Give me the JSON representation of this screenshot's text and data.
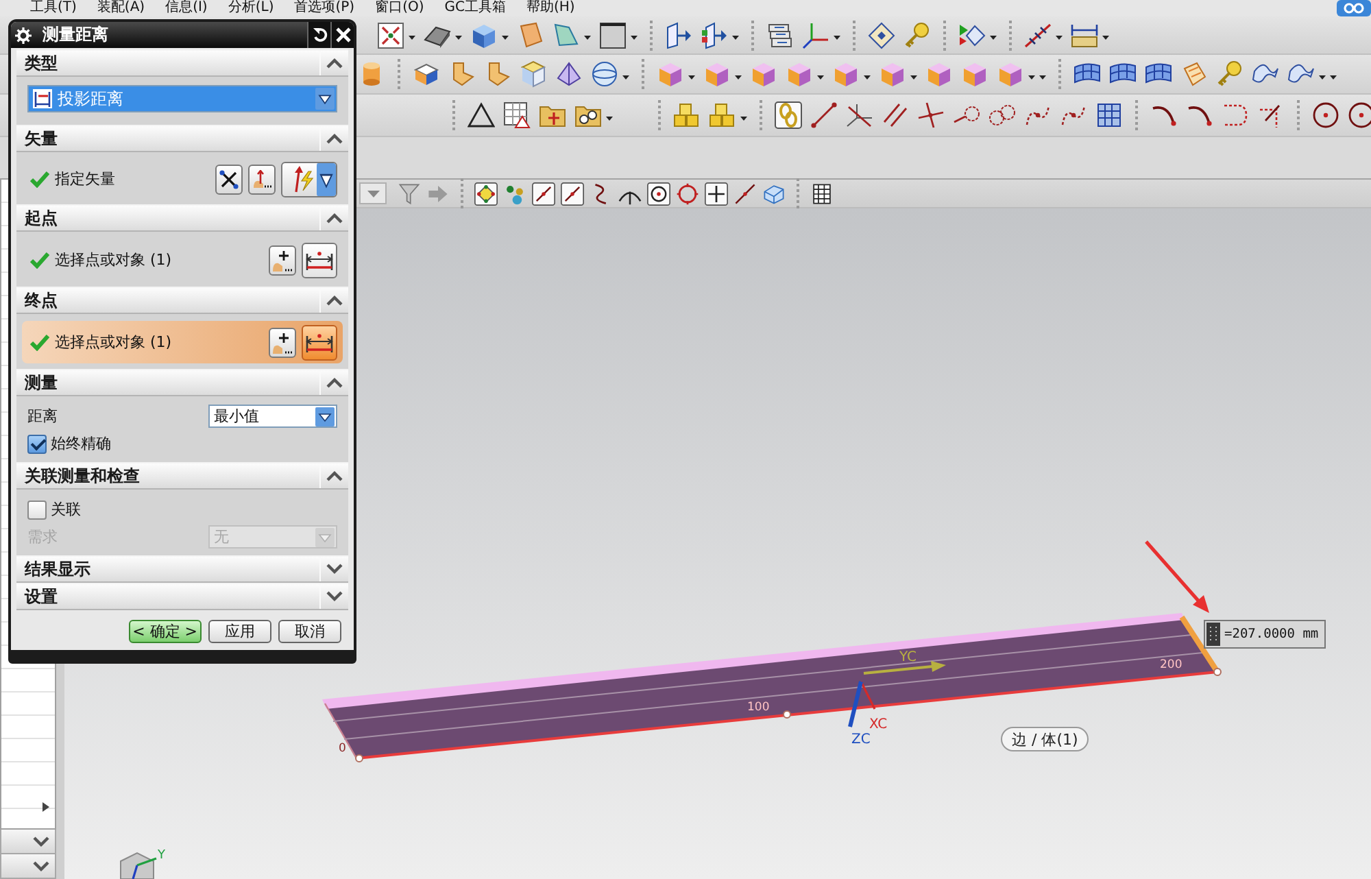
{
  "menu_bar": {
    "items": [
      "工具(T)",
      "装配(A)",
      "信息(I)",
      "分析(L)",
      "首选项(P)",
      "窗口(O)",
      "GC工具箱",
      "帮助(H)"
    ]
  },
  "dialog": {
    "title": "测量距离",
    "sections": [
      {
        "title": "类型",
        "expanded": true,
        "rows": [
          {
            "kind": "type",
            "value": "投影距离",
            "focused": true
          }
        ]
      },
      {
        "title": "矢量",
        "expanded": true,
        "rows": [
          {
            "kind": "vector",
            "label": "指定矢量",
            "done": true,
            "active": false
          }
        ]
      },
      {
        "title": "起点",
        "expanded": true,
        "rows": [
          {
            "kind": "point",
            "label": "选择点或对象 (1)",
            "done": true,
            "active": false
          }
        ]
      },
      {
        "title": "终点",
        "expanded": true,
        "rows": [
          {
            "kind": "point",
            "label": "选择点或对象 (1)",
            "done": true,
            "active": true
          }
        ]
      },
      {
        "title": "测量",
        "expanded": true,
        "rows": [
          {
            "kind": "select",
            "label": "距离",
            "value": "最小值",
            "disabled": false
          },
          {
            "kind": "checkbox",
            "label": "始终精确",
            "checked": true
          }
        ]
      },
      {
        "title": "关联测量和检查",
        "expanded": true,
        "rows": [
          {
            "kind": "checkbox",
            "label": "关联",
            "checked": false
          },
          {
            "kind": "select",
            "label": "需求",
            "value": "无",
            "disabled": true
          }
        ]
      },
      {
        "title": "结果显示",
        "expanded": false
      },
      {
        "title": "设置",
        "expanded": false
      }
    ],
    "buttons": [
      {
        "label": "< 确定 >",
        "default": true
      },
      {
        "label": "应用",
        "default": false
      },
      {
        "label": "取消",
        "default": false
      }
    ]
  },
  "viewport": {
    "scale_labels": [
      "0",
      "100",
      "200"
    ],
    "triad_axes": [
      {
        "label": "XC",
        "color": "#d42a2a"
      },
      {
        "label": "YC",
        "color": "#b8b040"
      },
      {
        "label": "ZC",
        "color": "#1f4fc0"
      }
    ],
    "measurement": "=207.0000 mm",
    "tooltip": "边 / 体(1)",
    "view_triad_label": "Y"
  }
}
